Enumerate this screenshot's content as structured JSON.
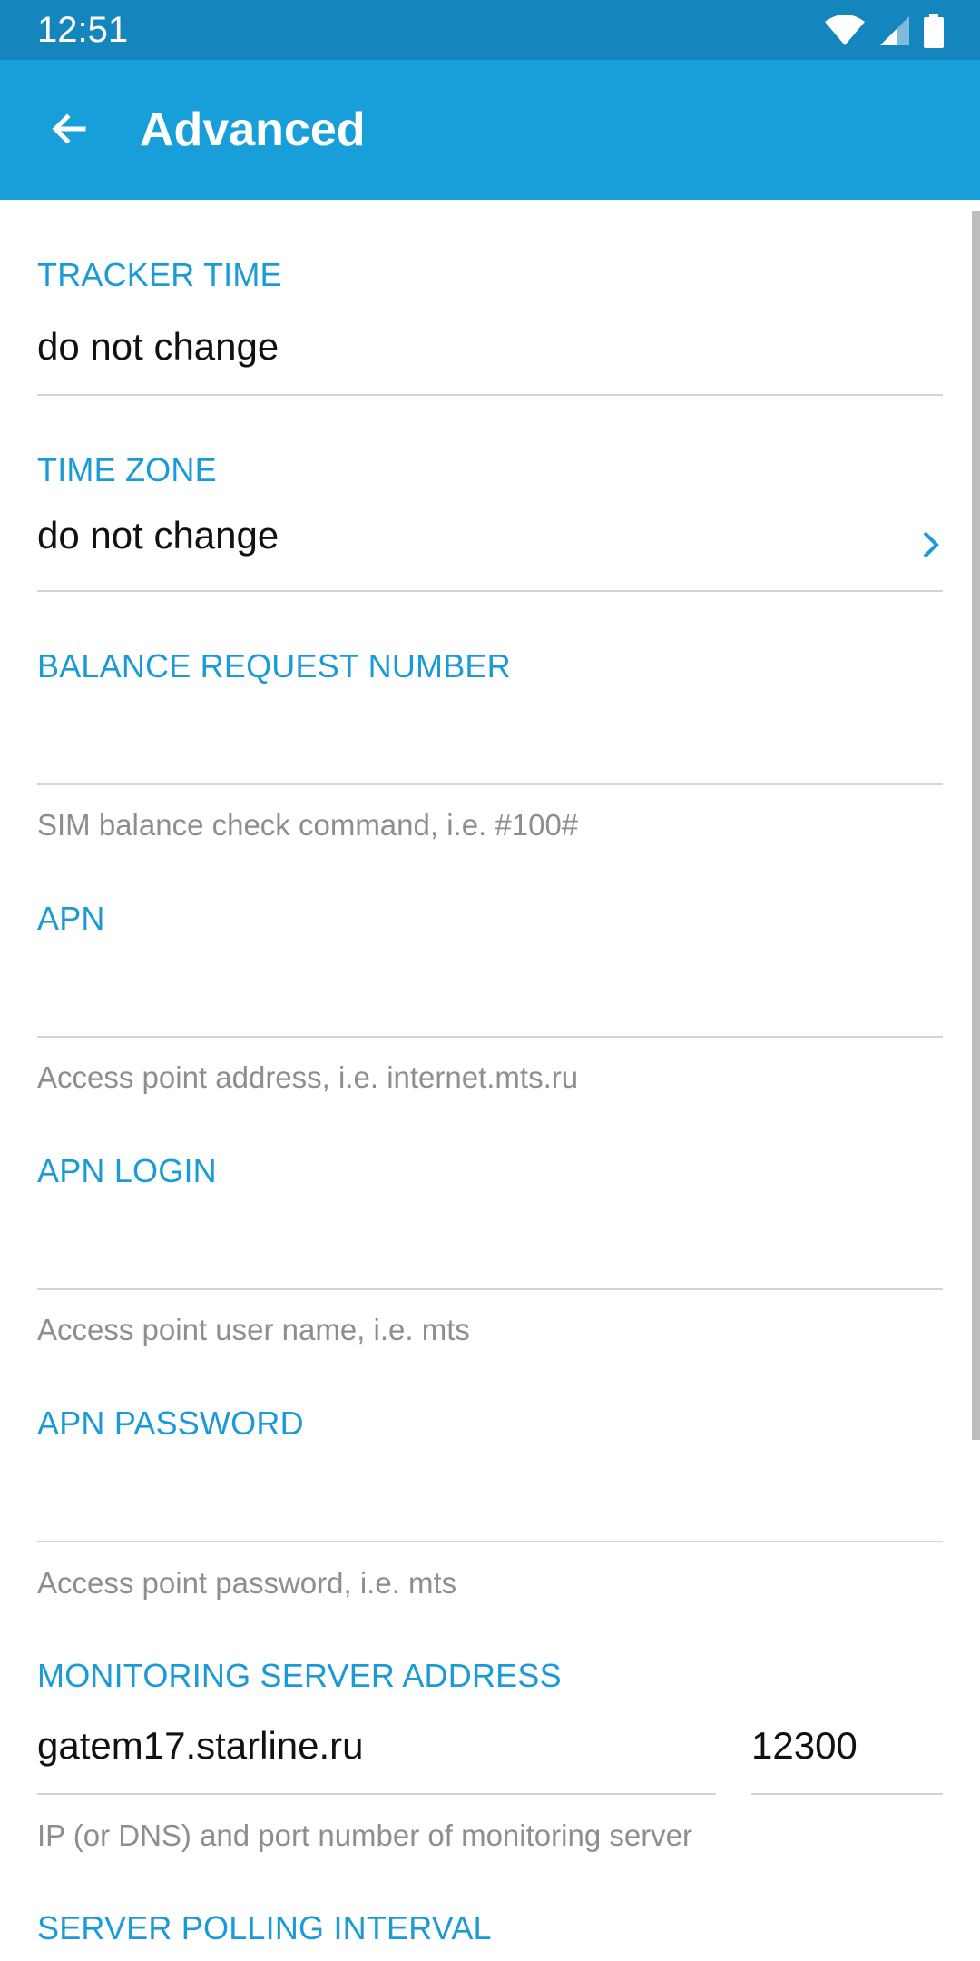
{
  "status_bar": {
    "time": "12:51",
    "icons": [
      "wifi-icon",
      "cellular-signal-icon",
      "battery-icon"
    ]
  },
  "app_bar": {
    "title": "Advanced",
    "back_icon": "arrow-left-icon"
  },
  "colors": {
    "status_bar": "#1486bd",
    "app_bar": "#189fd9",
    "accent": "#1a9bd7",
    "helper_text": "#8e8e8e",
    "divider": "#d4d4d4"
  },
  "fields": {
    "tracker_time": {
      "label": "TRACKER TIME",
      "value": "do not change"
    },
    "time_zone": {
      "label": "TIME ZONE",
      "value": "do not change",
      "icon": "chevron-right-icon"
    },
    "balance_request_number": {
      "label": "BALANCE REQUEST NUMBER",
      "value": "",
      "helper": "SIM balance check command, i.e. #100#"
    },
    "apn": {
      "label": "APN",
      "value": "",
      "helper": "Access point address, i.e. internet.mts.ru"
    },
    "apn_login": {
      "label": "APN LOGIN",
      "value": "",
      "helper": "Access point user name, i.e. mts"
    },
    "apn_password": {
      "label": "APN PASSWORD",
      "value": "",
      "helper": "Access point password, i.e. mts"
    },
    "monitoring_server_address": {
      "label": "MONITORING SERVER ADDRESS",
      "address": "gatem17.starline.ru",
      "port": "12300",
      "helper": "IP (or DNS) and port number of monitoring server"
    },
    "server_polling_interval": {
      "label": "SERVER POLLING INTERVAL"
    }
  }
}
